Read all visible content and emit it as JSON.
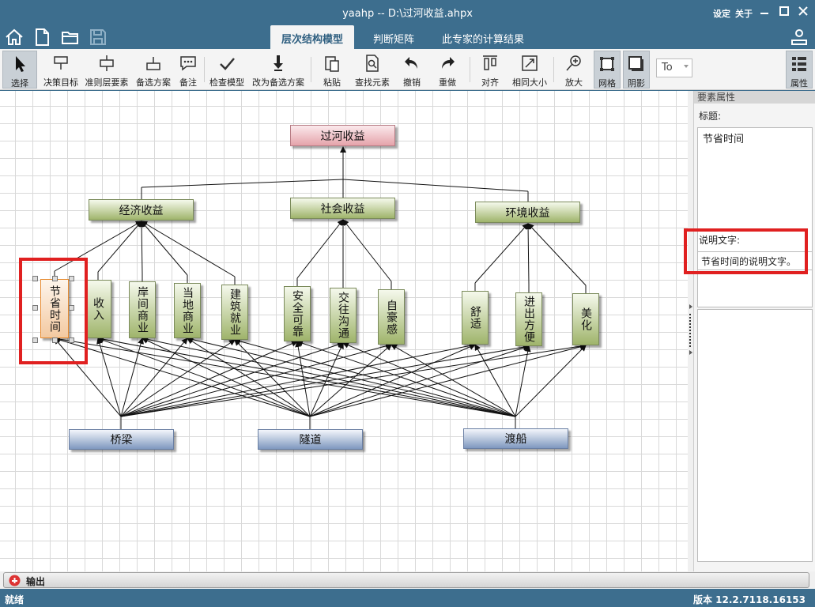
{
  "window": {
    "title": "yaahp -- D:\\过河收益.ahpx",
    "settings_label": "设定",
    "about_label": "关于"
  },
  "tabs": [
    {
      "label": "层次结构模型",
      "active": true
    },
    {
      "label": "判断矩阵",
      "active": false
    },
    {
      "label": "此专家的计算结果",
      "active": false
    }
  ],
  "toolbar": {
    "select": "选择",
    "decision_goal": "决策目标",
    "criteria_element": "准则层要素",
    "alternative": "备选方案",
    "note": "备注",
    "check_model": "检查模型",
    "to_alternative": "改为备选方案",
    "paste": "粘贴",
    "find_element": "查找元素",
    "undo": "撤销",
    "redo": "重做",
    "align": "对齐",
    "same_size": "相同大小",
    "zoom_in": "放大",
    "grid": "网格",
    "shadow": "阴影",
    "font_combo": "To",
    "properties": "属性"
  },
  "model": {
    "goal": "过河收益",
    "criteria": [
      "经济收益",
      "社会收益",
      "环境收益"
    ],
    "subcriteria": [
      "节省时间",
      "收入",
      "岸间商业",
      "当地商业",
      "建筑就业",
      "安全可靠",
      "交往沟通",
      "自豪感",
      "舒适",
      "进出方便",
      "美化"
    ],
    "alternatives": [
      "桥梁",
      "隧道",
      "渡船"
    ]
  },
  "properties_panel": {
    "header": "要素属性",
    "title_label": "标题:",
    "title_value": "节省时间",
    "desc_label": "说明文字:",
    "desc_value": "节省时间的说明文字。"
  },
  "output": {
    "label": "输出"
  },
  "status": {
    "left": "就绪",
    "version": "版本 12.2.7118.16153"
  }
}
